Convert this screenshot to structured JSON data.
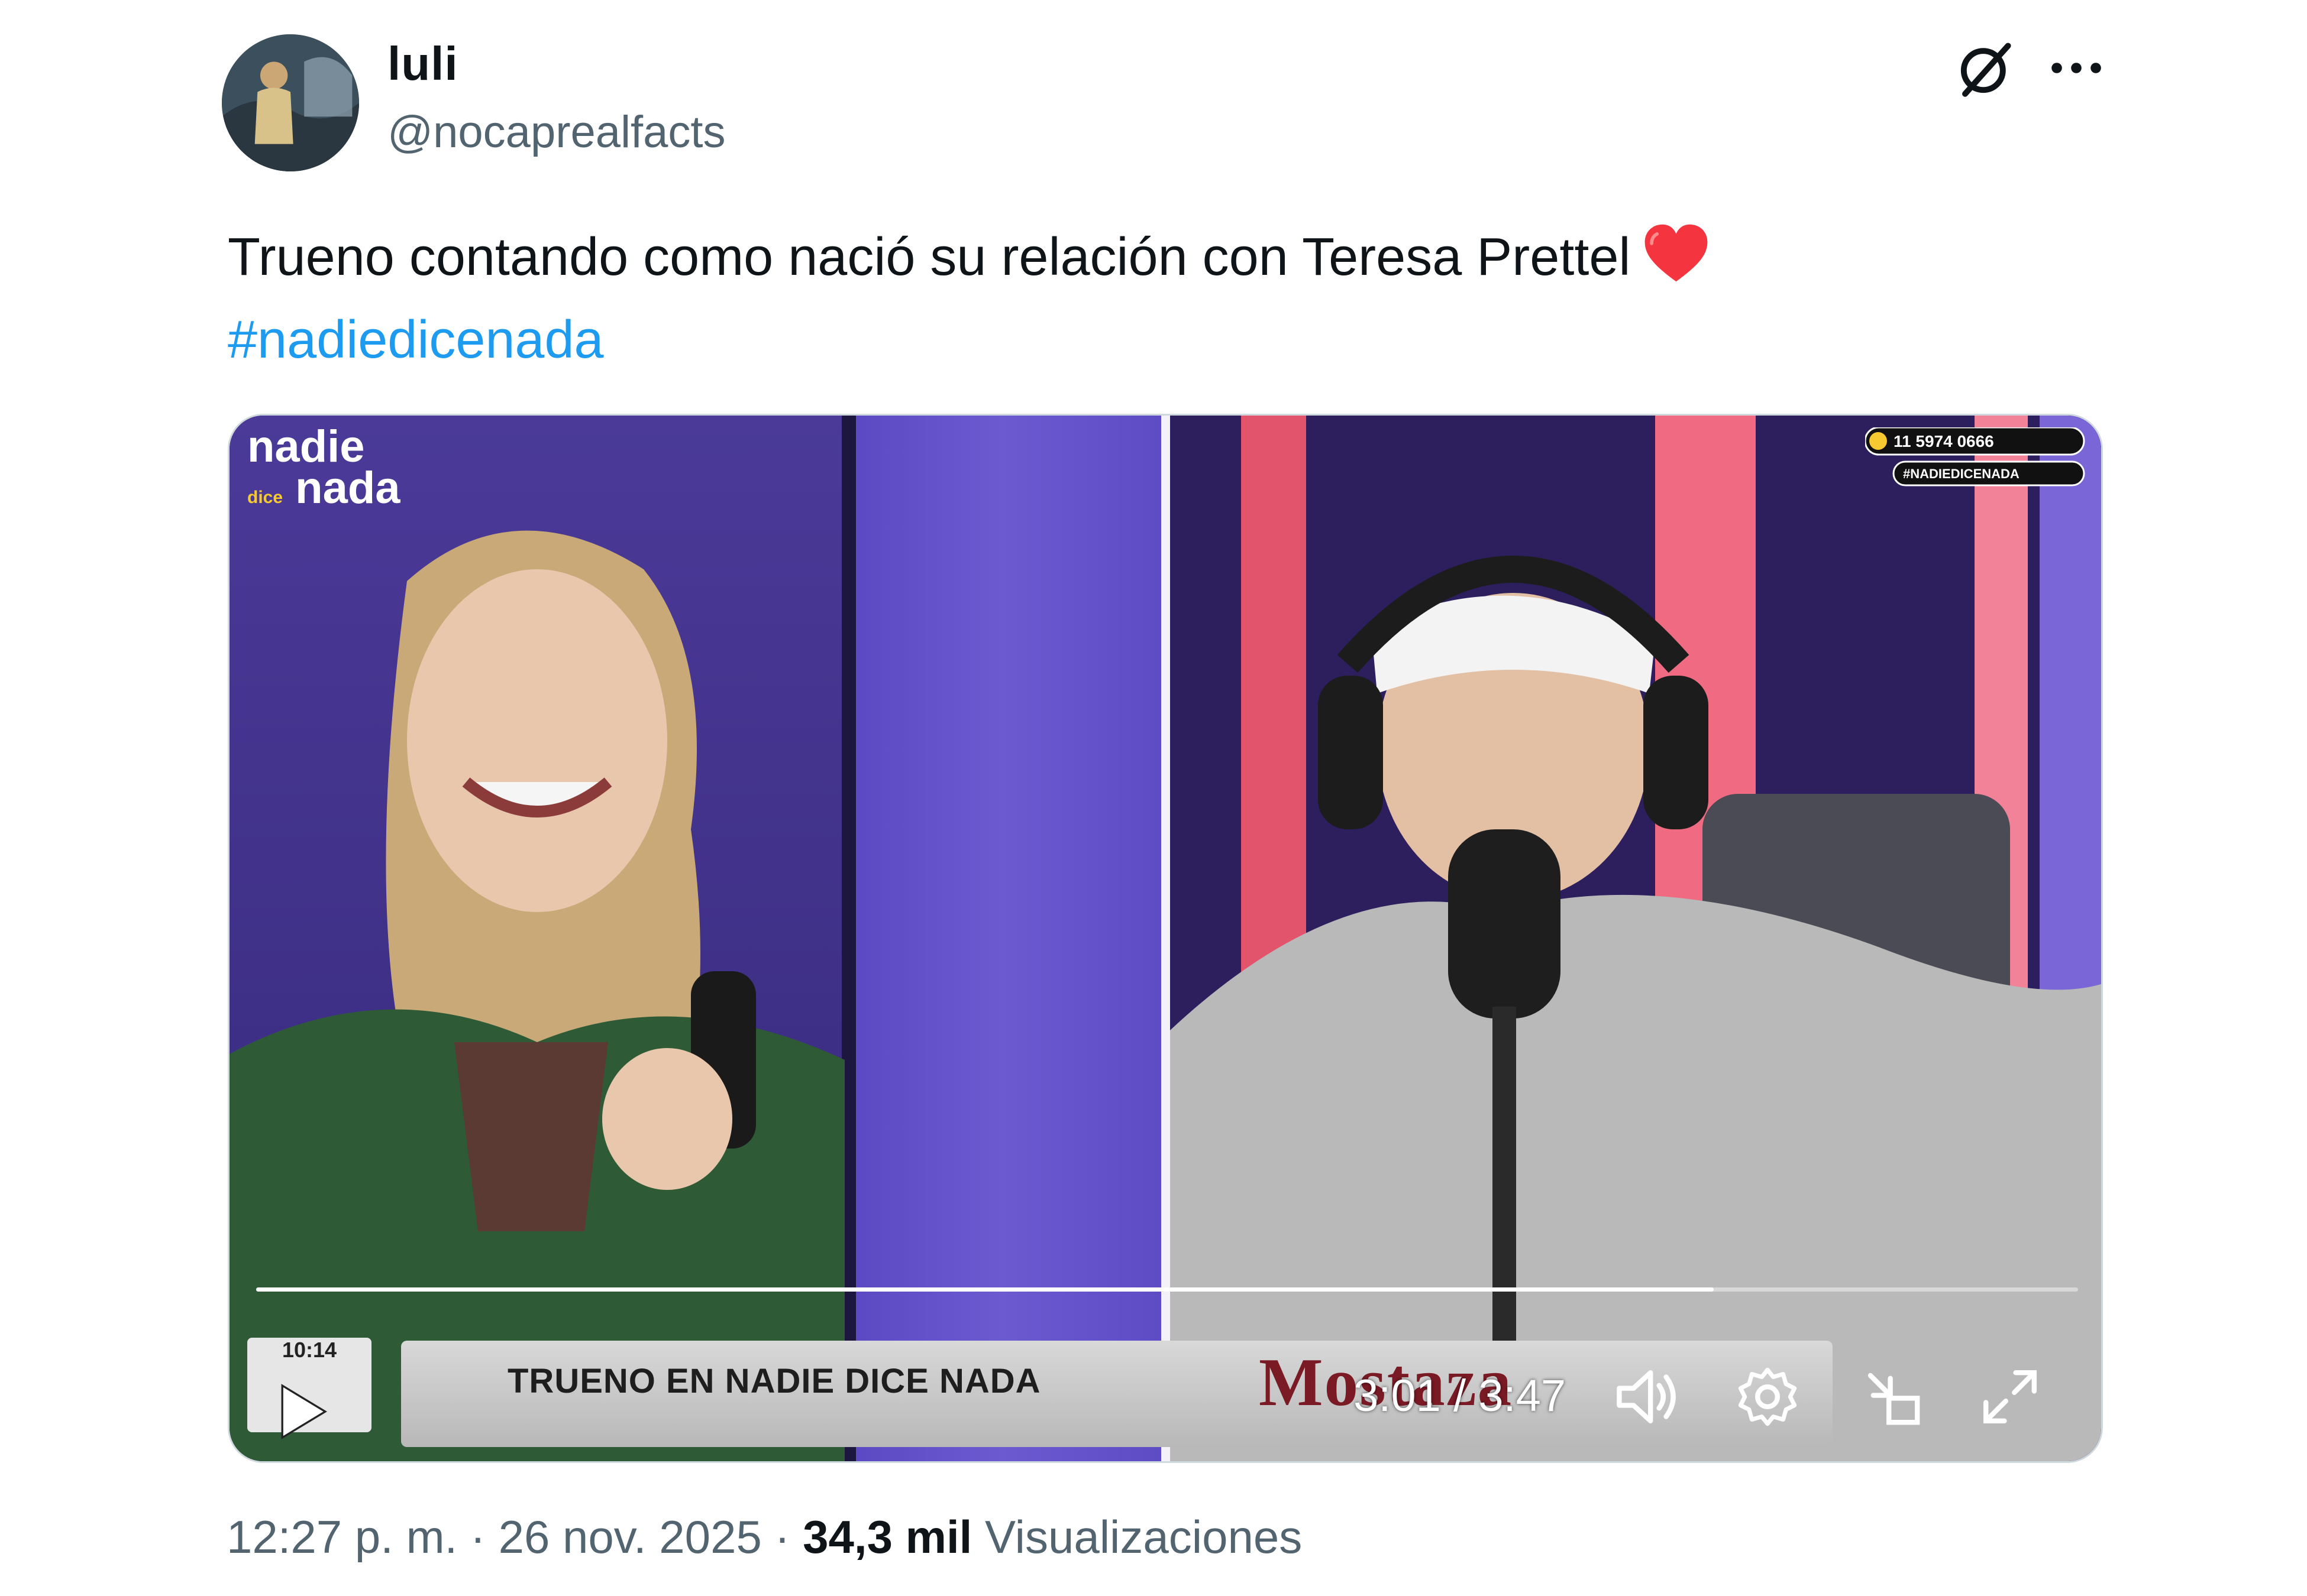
{
  "author": {
    "display_name": "luli",
    "handle": "@nocaprealfacts",
    "avatar_icon": "avatar-photo"
  },
  "header_actions": {
    "grok_icon": "grok-slash-icon",
    "more_icon": "more-dots-icon"
  },
  "tweet": {
    "text": "Trueno contando como nació su relación con Teresa Prettel",
    "emoji": "red-heart",
    "hashtag": "#nadiedicenada"
  },
  "video": {
    "show_logo_line1": "nadie",
    "show_logo_line2": "nada",
    "show_logo_small": "dice",
    "live_badge": "11 5974 0666",
    "live_badge_tag": "#NADIEDICENADA",
    "clock": "10:14",
    "lower_third": "TRUENO EN NADIE DICE NADA",
    "sponsor": "Mostaza",
    "time_display": "3:01 / 3:47",
    "progress": 0.8,
    "controls": [
      "play-icon",
      "volume-icon",
      "settings-icon",
      "pip-icon",
      "fullscreen-icon"
    ]
  },
  "footer": {
    "time": "12:27 p. m.",
    "separator": " · ",
    "date": "26 nov. 2025",
    "views_count": "34,3 mil",
    "views_label": "Visualizaciones"
  },
  "colors": {
    "hashtag": "#1d9bf0",
    "text": "#0f1419",
    "secondary": "#536471",
    "heart": "#f91880"
  }
}
